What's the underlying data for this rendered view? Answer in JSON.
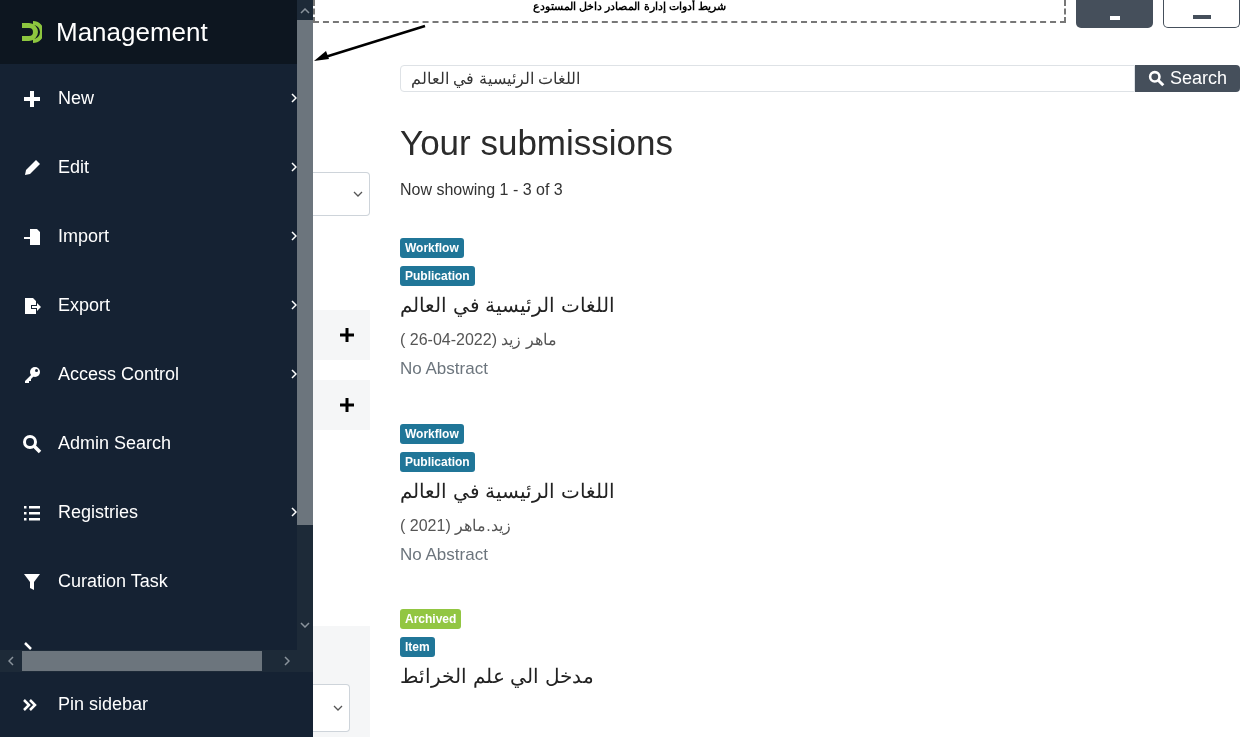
{
  "annotation": {
    "text": "شريط أدوات إدارة المصادر داخل المستودع"
  },
  "sidebar": {
    "title": "Management",
    "items": [
      {
        "label": "New",
        "submenu": true
      },
      {
        "label": "Edit",
        "submenu": true
      },
      {
        "label": "Import",
        "submenu": true
      },
      {
        "label": "Export",
        "submenu": true
      },
      {
        "label": "Access Control",
        "submenu": true
      },
      {
        "label": "Admin Search",
        "submenu": false
      },
      {
        "label": "Registries",
        "submenu": true
      },
      {
        "label": "Curation Task",
        "submenu": false
      }
    ],
    "pin": {
      "label": "Pin sidebar"
    }
  },
  "search": {
    "value": "اللغات الرئيسية في العالم",
    "button": "Search"
  },
  "heading": "Your submissions",
  "count": "Now showing 1 - 3 of 3",
  "results": [
    {
      "badges": [
        {
          "label": "Workflow",
          "color": "#207698"
        },
        {
          "label": "Publication",
          "color": "#207698"
        }
      ],
      "title": "اللغات الرئيسية في العالم",
      "meta": "ماهر زيد (2022-04-26 )",
      "abstract": "No Abstract"
    },
    {
      "badges": [
        {
          "label": "Workflow",
          "color": "#207698"
        },
        {
          "label": "Publication",
          "color": "#207698"
        }
      ],
      "title": "اللغات الرئيسية في العالم",
      "meta": "زيد.ماهر (2021 )",
      "abstract": "No Abstract"
    },
    {
      "badges": [
        {
          "label": "Archived",
          "color": "#92c642"
        },
        {
          "label": "Item",
          "color": "#207698"
        }
      ],
      "title": "مدخل الي علم الخرائط"
    }
  ]
}
